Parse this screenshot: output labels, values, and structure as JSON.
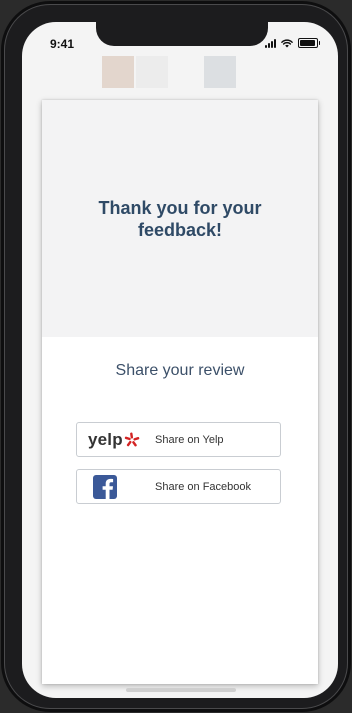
{
  "status_bar": {
    "time": "9:41"
  },
  "header": {
    "logo_colors": [
      "#e3d6cd",
      "#ececec",
      "#dcdfe2"
    ]
  },
  "feedback": {
    "thank_you": "Thank you for your feedback!"
  },
  "share": {
    "title": "Share your review",
    "yelp": {
      "logo_text": "yelp",
      "label": "Share on Yelp",
      "brand_color": "#d32323"
    },
    "facebook": {
      "label": "Share on Facebook",
      "brand_color": "#3b5998"
    }
  },
  "colors": {
    "heading": "#2f4a66",
    "panel_bg": "#f3f3f4"
  }
}
